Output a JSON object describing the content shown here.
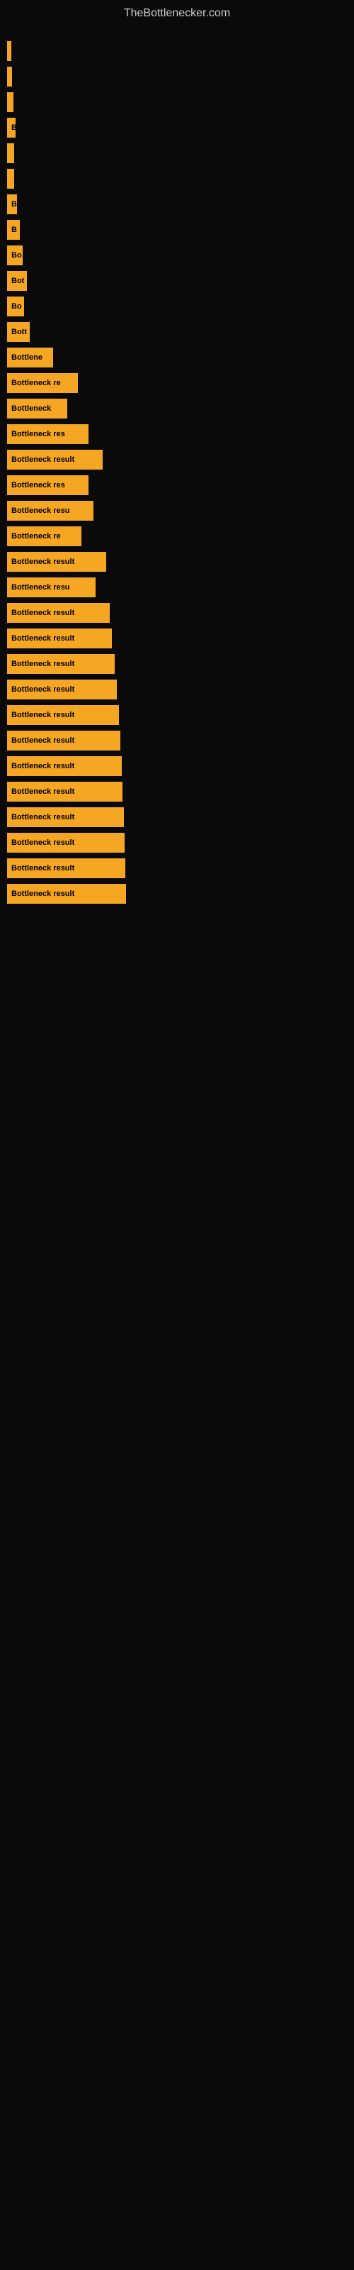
{
  "site": {
    "title": "TheBottlenecker.com"
  },
  "bars": [
    {
      "label": "",
      "width": 5
    },
    {
      "label": "",
      "width": 7
    },
    {
      "label": "",
      "width": 9
    },
    {
      "label": "B",
      "width": 12
    },
    {
      "label": "",
      "width": 10
    },
    {
      "label": "",
      "width": 10
    },
    {
      "label": "B",
      "width": 14
    },
    {
      "label": "B",
      "width": 18
    },
    {
      "label": "Bo",
      "width": 22
    },
    {
      "label": "Bot",
      "width": 28
    },
    {
      "label": "Bo",
      "width": 24
    },
    {
      "label": "Bott",
      "width": 32
    },
    {
      "label": "Bottlene",
      "width": 65
    },
    {
      "label": "Bottleneck re",
      "width": 100
    },
    {
      "label": "Bottleneck",
      "width": 85
    },
    {
      "label": "Bottleneck res",
      "width": 115
    },
    {
      "label": "Bottleneck result",
      "width": 135
    },
    {
      "label": "Bottleneck res",
      "width": 115
    },
    {
      "label": "Bottleneck resu",
      "width": 122
    },
    {
      "label": "Bottleneck re",
      "width": 105
    },
    {
      "label": "Bottleneck result",
      "width": 140
    },
    {
      "label": "Bottleneck resu",
      "width": 125
    },
    {
      "label": "Bottleneck result",
      "width": 145
    },
    {
      "label": "Bottleneck result",
      "width": 148
    },
    {
      "label": "Bottleneck result",
      "width": 152
    },
    {
      "label": "Bottleneck result",
      "width": 155
    },
    {
      "label": "Bottleneck result",
      "width": 158
    },
    {
      "label": "Bottleneck result",
      "width": 160
    },
    {
      "label": "Bottleneck result",
      "width": 162
    },
    {
      "label": "Bottleneck result",
      "width": 163
    },
    {
      "label": "Bottleneck result",
      "width": 165
    },
    {
      "label": "Bottleneck result",
      "width": 166
    },
    {
      "label": "Bottleneck result",
      "width": 167
    },
    {
      "label": "Bottleneck result",
      "width": 168
    }
  ]
}
